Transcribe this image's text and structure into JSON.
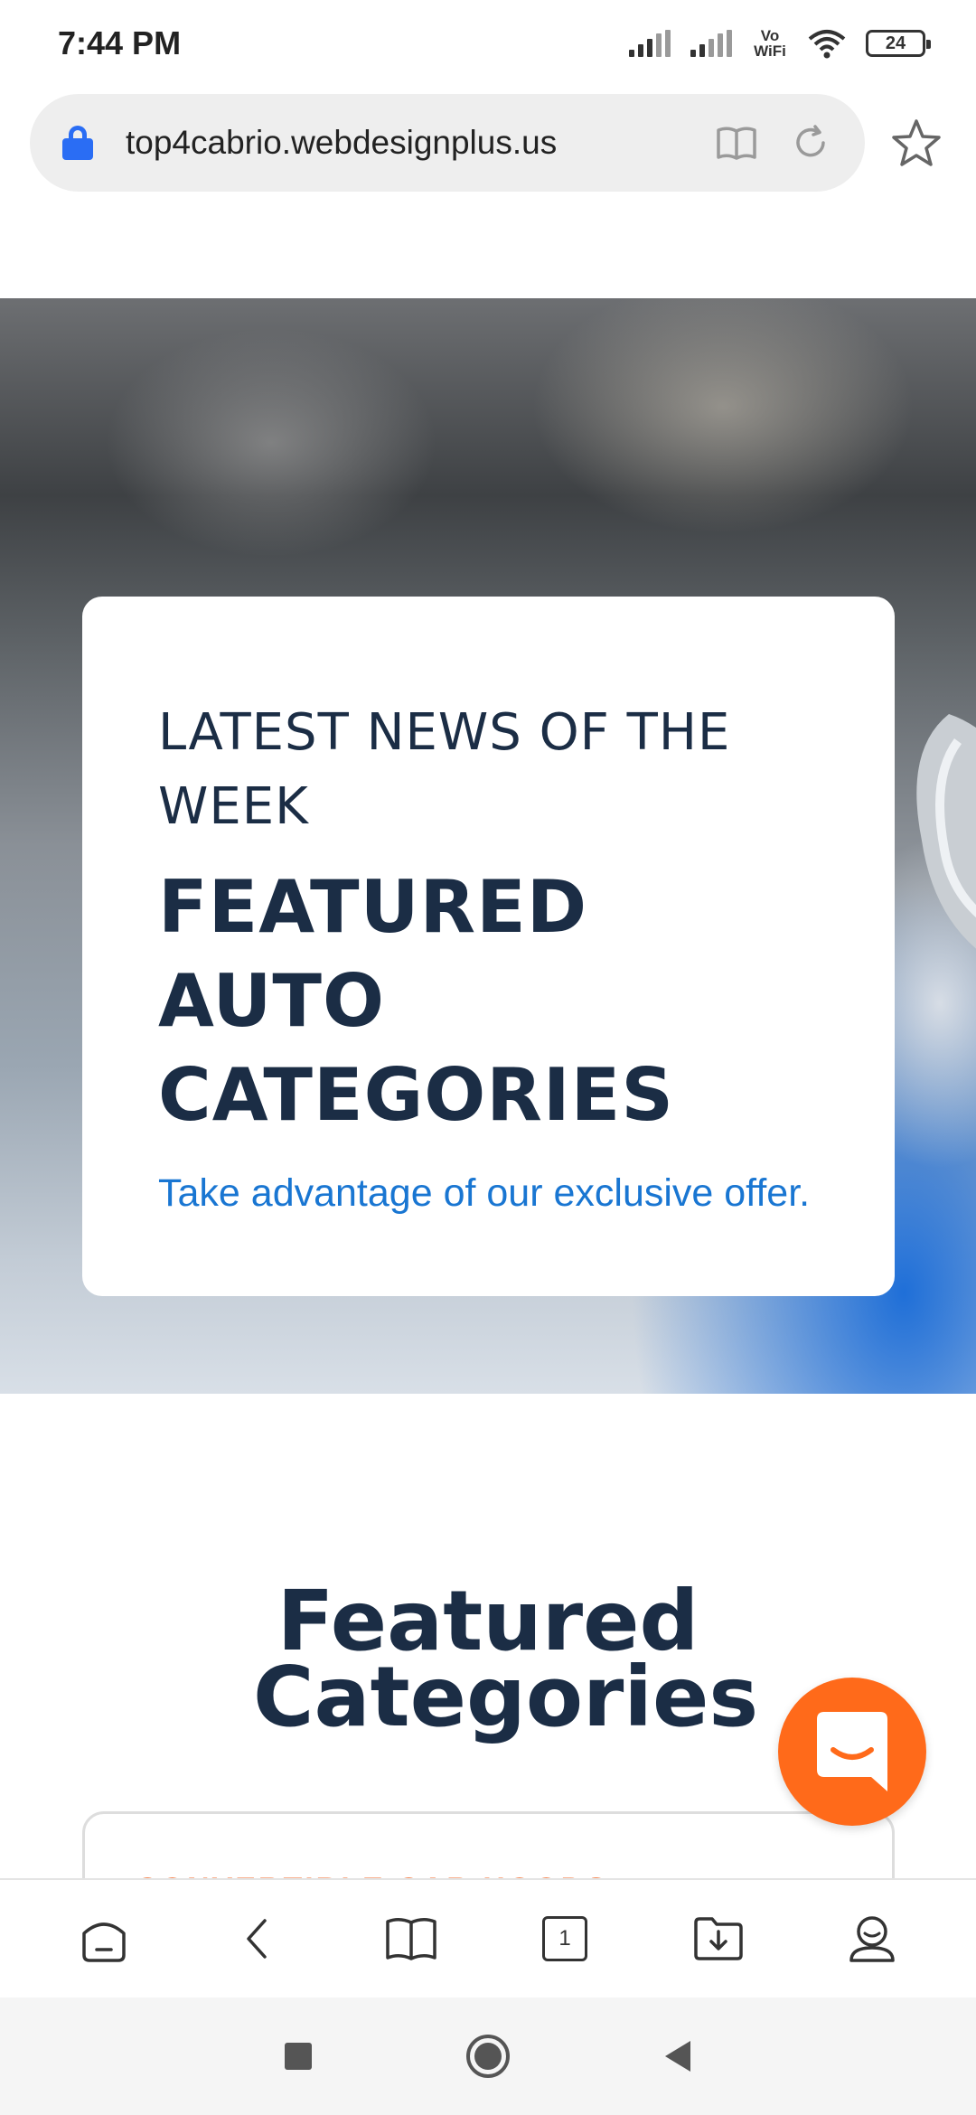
{
  "status_bar": {
    "time": "7:44 PM",
    "vowifi_label": "Vo WiFi",
    "battery_level": "24"
  },
  "browser": {
    "url": "top4cabrio.webdesignplus.us",
    "icons": [
      "lock-icon",
      "reader-mode-icon",
      "reload-icon",
      "bookmark-star-icon"
    ]
  },
  "hero": {
    "eyebrow": "LATEST NEWS OF THE WEEK",
    "title": "FEATURED AUTO CATEGORIES",
    "link_text": "Take advantage of our exclusive offer."
  },
  "featured": {
    "title": "Featured Categories",
    "first_card_label": "CONVERTIBLE CAR HOODS"
  },
  "toolbar": {
    "tabs_count": "1",
    "icons": [
      "home-icon",
      "back-icon",
      "bookmarks-icon",
      "tabs-icon",
      "downloads-icon",
      "profile-icon"
    ]
  },
  "colors": {
    "accent_blue": "#1976d2",
    "heading_navy": "#1b2d45",
    "chat_orange": "#ff6a1a",
    "lock_blue": "#2a6df4"
  }
}
